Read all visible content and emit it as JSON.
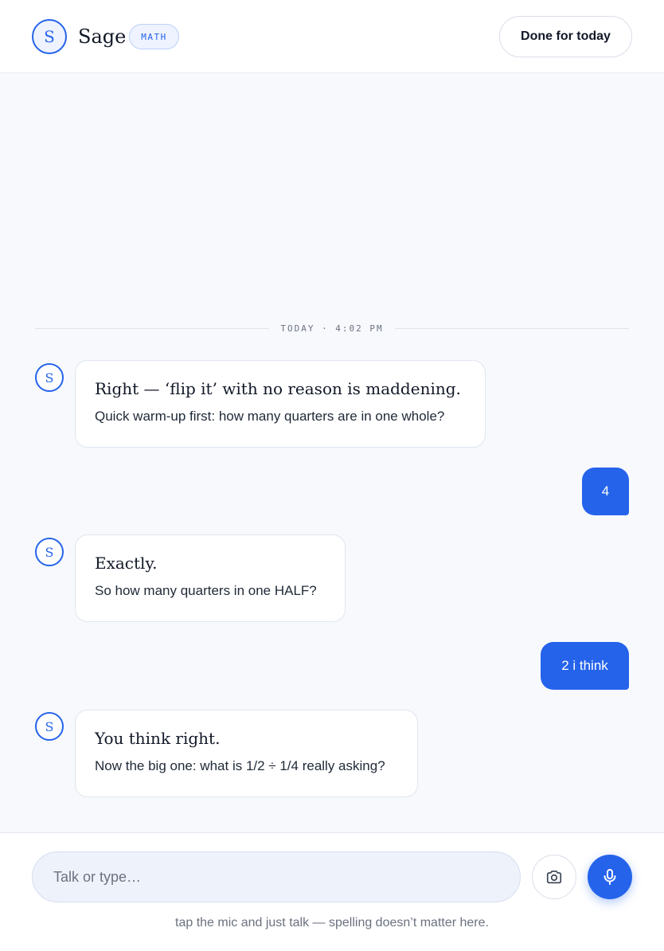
{
  "header": {
    "logo_letter": "S",
    "app_name": "Sage",
    "subject_badge": "MATH",
    "done_button_label": "Done for today"
  },
  "timestamp_divider": "TODAY · 4:02 PM",
  "messages": [
    {
      "from": "tutor",
      "avatar": "S",
      "headline": "Right — ‘flip it’ with no reason is maddening.",
      "body": "Quick warm-up first: how many quarters are in one whole?"
    },
    {
      "from": "student",
      "text": "4"
    },
    {
      "from": "tutor",
      "avatar": "S",
      "headline": "Exactly.",
      "body": "So how many quarters in one HALF?"
    },
    {
      "from": "student",
      "text": "2 i think"
    },
    {
      "from": "tutor",
      "avatar": "S",
      "headline": "You think right.",
      "body": "Now the big one: what is 1/2 ÷ 1/4 really asking?"
    }
  ],
  "composer": {
    "input_value": "",
    "input_placeholder": "Talk or type…",
    "camera_icon": "camera-icon",
    "mic_icon": "microphone-icon",
    "hint": "tap the mic and just talk — spelling doesn’t matter here."
  },
  "colors": {
    "accent": "#2563eb",
    "background": "#f7f9fc",
    "surface": "#ffffff"
  }
}
